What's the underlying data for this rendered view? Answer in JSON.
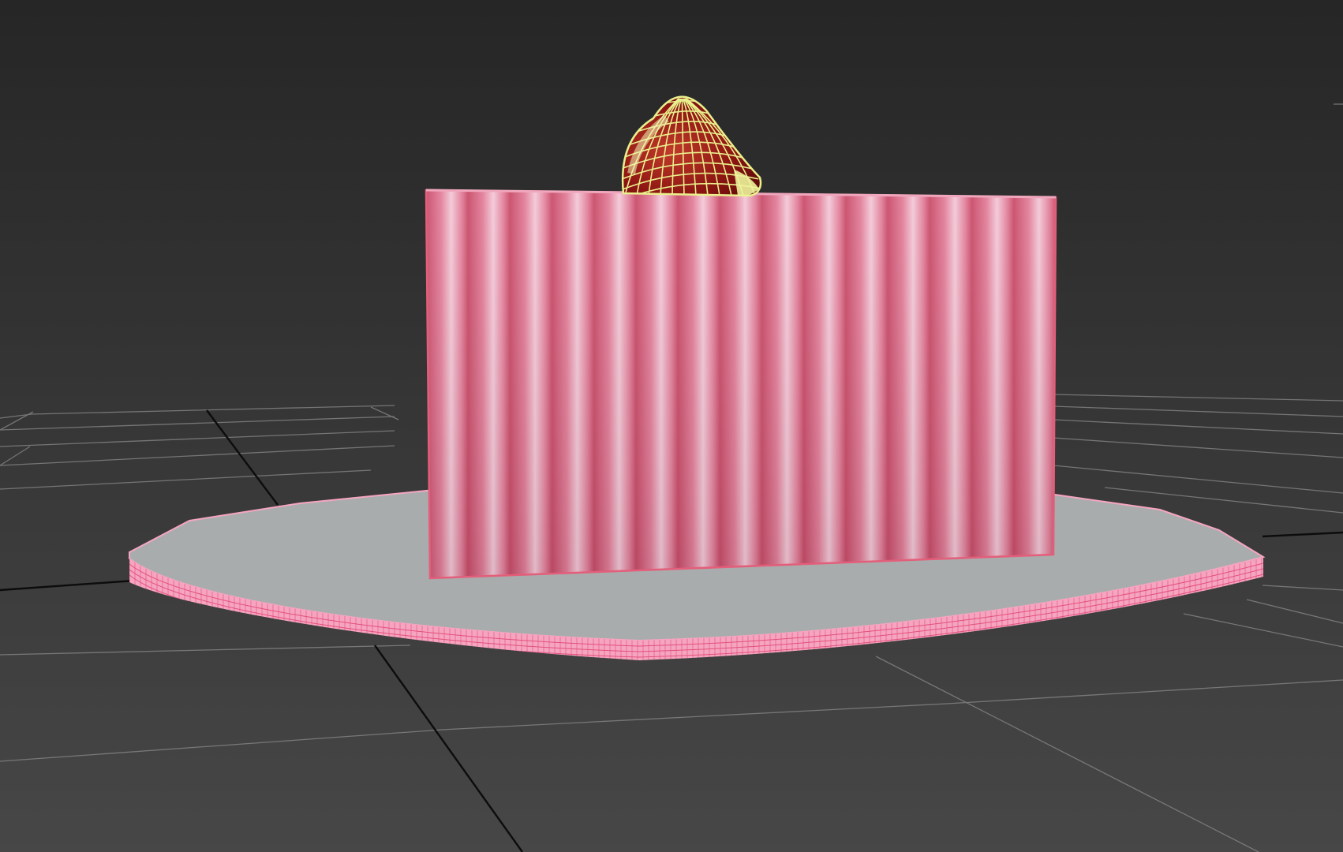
{
  "viewport": {
    "background_top": "#262626",
    "background_bottom": "#474747",
    "grid_color": "#8a8a8a",
    "axis_color": "#0c0c0c"
  },
  "objects": {
    "cake": {
      "color": "#e27f9a",
      "highlight": "#f3c9d8",
      "shadow": "#c94e6b",
      "edge": "#e35e7a"
    },
    "plate": {
      "top_color": "#a9acad",
      "rim_color": "#f6a5c0",
      "wire_color": "#e2507c"
    },
    "strawberry": {
      "color": "#8c1512",
      "wire_color": "#e9f08c"
    }
  }
}
